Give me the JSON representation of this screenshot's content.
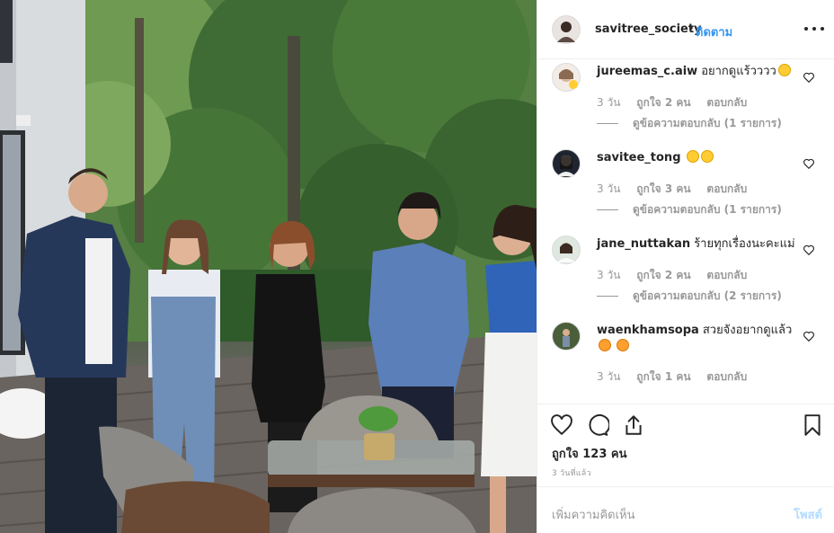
{
  "post": {
    "username": "savitree_society",
    "separator": "•",
    "follow_label": "ติดตาม",
    "likes_text": "ถูกใจ 123 คน",
    "time_ago": "3 วันที่แล้ว"
  },
  "comments": [
    {
      "username": "jureemas_c.aiw",
      "text": "อยากดูแร้วววว",
      "emojis": [
        "grinning-face"
      ],
      "age": "3 วัน",
      "likes": "ถูกใจ 2 คน",
      "reply_label": "ตอบกลับ",
      "view_replies": "ดูข้อความตอบกลับ (1 รายการ)"
    },
    {
      "username": "savitee_tong",
      "text": "",
      "emojis": [
        "tongue-face",
        "tongue-face"
      ],
      "age": "3 วัน",
      "likes": "ถูกใจ 3 คน",
      "reply_label": "ตอบกลับ",
      "view_replies": "ดูข้อความตอบกลับ (1 รายการ)"
    },
    {
      "username": "jane_nuttakan",
      "text": "ร้ายทุกเรื่องนะคะแม่",
      "emojis": [],
      "age": "3 วัน",
      "likes": "ถูกใจ 2 คน",
      "reply_label": "ตอบกลับ",
      "view_replies": "ดูข้อความตอบกลับ (2 รายการ)"
    },
    {
      "username": "waenkhamsopa",
      "text": "สวยจังอยากดูแล้ว",
      "emojis": [
        "star-struck",
        "star-struck"
      ],
      "age": "3 วัน",
      "likes": "ถูกใจ 1 คน",
      "reply_label": "ตอบกลับ",
      "view_replies": ""
    }
  ],
  "add_comment": {
    "placeholder": "เพิ่มความคิดเห็น",
    "post_label": "โพสต์"
  },
  "icons": {
    "like": "heart-icon",
    "comment": "comment-bubble-icon",
    "share": "share-icon",
    "save": "bookmark-icon",
    "more": "more-options-icon"
  },
  "colors": {
    "accent": "#3897f0",
    "post_disabled": "#b3dbff",
    "muted": "#999999",
    "text": "#262626",
    "border": "#efefef"
  }
}
